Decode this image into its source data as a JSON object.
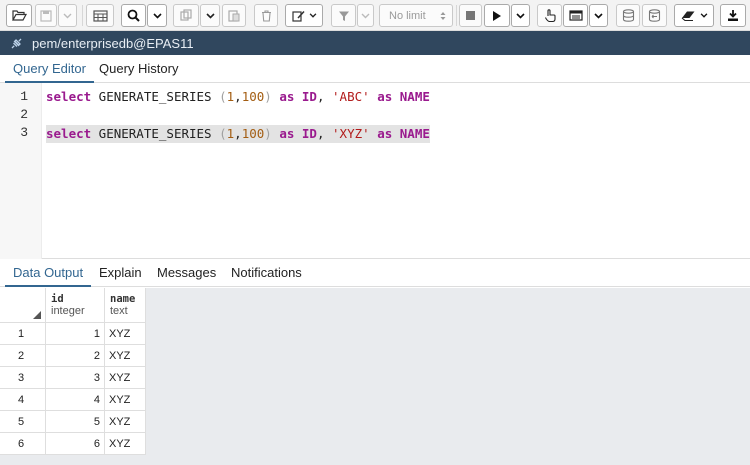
{
  "toolbar": {
    "limit_label": "No limit",
    "icons": [
      "folder-open-icon",
      "save-icon",
      "chevron-down-icon",
      "table-icon",
      "search-icon",
      "chevron-down-icon",
      "copy-icon",
      "chevron-down-icon",
      "paste-icon",
      "trash-icon",
      "edit-icon",
      "chevron-down-icon",
      "filter-icon",
      "chevron-down-icon",
      "stop-icon",
      "play-icon",
      "chevron-down-icon",
      "hand-icon",
      "explain-icon",
      "chevron-down-icon",
      "commit-icon",
      "rollback-icon",
      "eraser-icon",
      "chevron-down-icon",
      "download-icon"
    ]
  },
  "connection": {
    "label": "pem/enterprisedb@EPAS11"
  },
  "query_tabs": [
    "Query Editor",
    "Query History"
  ],
  "editor": {
    "line_numbers": [
      "1",
      "2",
      "3"
    ],
    "lines": [
      {
        "kw1": "select",
        "fn": " GENERATE_SERIES ",
        "p1": "(",
        "n1": "1",
        "comma": ",",
        "n2": "100",
        "p2": ")",
        "kw2": " as ",
        "id": "ID",
        "comma2": ", ",
        "str": "'ABC'",
        "kw3": " as ",
        "name": "NAME"
      },
      {
        "kw1": "select",
        "fn": " GENERATE_SERIES ",
        "p1": "(",
        "n1": "1",
        "comma": ",",
        "n2": "100",
        "p2": ")",
        "kw2": " as ",
        "id": "ID",
        "comma2": ", ",
        "str": "'XYZ'",
        "kw3": " as ",
        "name": "NAME"
      }
    ]
  },
  "output_tabs": [
    "Data Output",
    "Explain",
    "Messages",
    "Notifications"
  ],
  "grid": {
    "columns": [
      {
        "name": "id",
        "type": "integer"
      },
      {
        "name": "name",
        "type": "text"
      }
    ],
    "rows": [
      {
        "rownum": "1",
        "id": "1",
        "name": "XYZ"
      },
      {
        "rownum": "2",
        "id": "2",
        "name": "XYZ"
      },
      {
        "rownum": "3",
        "id": "3",
        "name": "XYZ"
      },
      {
        "rownum": "4",
        "id": "4",
        "name": "XYZ"
      },
      {
        "rownum": "5",
        "id": "5",
        "name": "XYZ"
      },
      {
        "rownum": "6",
        "id": "6",
        "name": "XYZ"
      }
    ]
  },
  "colors": {
    "accent": "#326690",
    "connbar": "#30475e",
    "keyword": "#9a1a8e",
    "number": "#a35d12",
    "string": "#b21b1b"
  }
}
